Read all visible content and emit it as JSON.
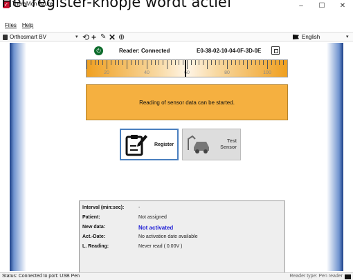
{
  "caption": "Het register-knopje wordt actief",
  "window": {
    "title": "TheraMon Azure",
    "controls": [
      "–",
      "☐",
      "✕"
    ]
  },
  "menu": {
    "files": "Files",
    "help": "Help"
  },
  "toolbar": {
    "company": "Orthosmart BV",
    "language": "English",
    "tools": [
      "refresh-icon",
      "add-icon",
      "edit-icon",
      "delete-icon",
      "globe-icon"
    ]
  },
  "reader": {
    "status": "Reader: Connected",
    "id": "E0-38-02-10-04-0F-3D-0E"
  },
  "gauge": {
    "ticks": [
      "20",
      "40",
      "60",
      "80",
      "100"
    ],
    "min": 10,
    "max": 110,
    "value": 59
  },
  "message": "Reading of sensor data can be started.",
  "buttons": {
    "register": "Register",
    "test_line1": "Test",
    "test_line2": "Sensor"
  },
  "info": [
    {
      "label": "Interval (min:sec):",
      "value": "-"
    },
    {
      "label": "Patient:",
      "value": "Not assigned"
    },
    {
      "label": "New data:",
      "value": "Not activated"
    },
    {
      "label": "Act.-Date:",
      "value": "No activation date available"
    },
    {
      "label": "L. Reading:",
      "value": "Never read ( 0.00V )"
    }
  ],
  "status": {
    "left": "Status: Connected to port: USB Pen",
    "right": "Reader type: Pen reader"
  }
}
